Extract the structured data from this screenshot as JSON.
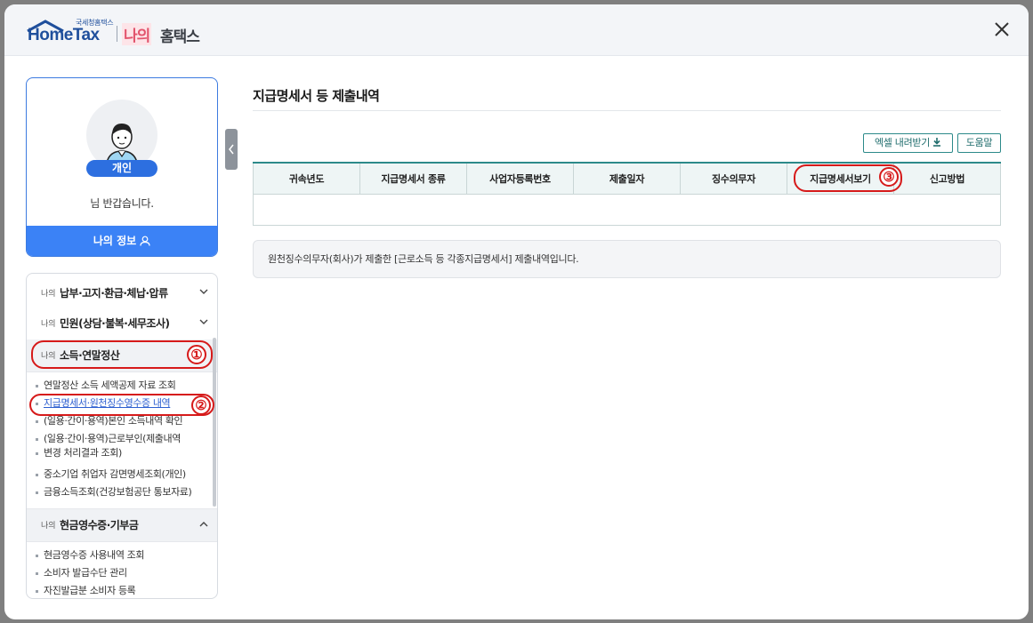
{
  "header": {
    "logo_sub": "국세청홈택스",
    "logo_brand": "HomeTax",
    "logo_mine": "나의",
    "logo_hometax": "홈택스"
  },
  "profile": {
    "badge": "개인",
    "greeting": "님 반갑습니다.",
    "my_info_label": "나의 정보"
  },
  "menu": {
    "prefix": "나의",
    "sections": [
      {
        "label": "납부·고지·환급·체납·압류"
      },
      {
        "label": "민원(상담·불복·세무조사)"
      },
      {
        "label": "소득·연말정산"
      },
      {
        "label": "현금영수증·기부금"
      }
    ],
    "income_items": [
      "연말정산 소득 세액공제 자료 조회",
      "지급명세서·원천징수영수증 내역",
      "(일용·간이·용역)본인 소득내역 확인",
      "(일용·간이·용역)근로부인(제출내역",
      "변경 처리결과 조회)",
      "중소기업 취업자 감면명세조회(개인)",
      "금융소득조회(건강보험공단 통보자료)"
    ],
    "cash_items": [
      "현금영수증 사용내역 조회",
      "소비자 발급수단 관리",
      "자진발급분 소비자 등록"
    ]
  },
  "annotations": [
    "①",
    "②",
    "③"
  ],
  "main": {
    "title": "지급명세서 등 제출내역",
    "excel_button": "엑셀 내려받기",
    "help_button": "도움말",
    "columns": [
      "귀속년도",
      "지급명세서 종류",
      "사업자등록번호",
      "제출일자",
      "징수의무자",
      "지급명세서보기",
      "신고방법"
    ],
    "notice": "원천징수의무자(회사)가 제출한 [근로소득 등 각종지급명세서] 제출내역입니다."
  },
  "colors": {
    "accent_blue": "#3b82f6",
    "teal": "#2c8a8a",
    "annotation_red": "#d61a1a"
  }
}
